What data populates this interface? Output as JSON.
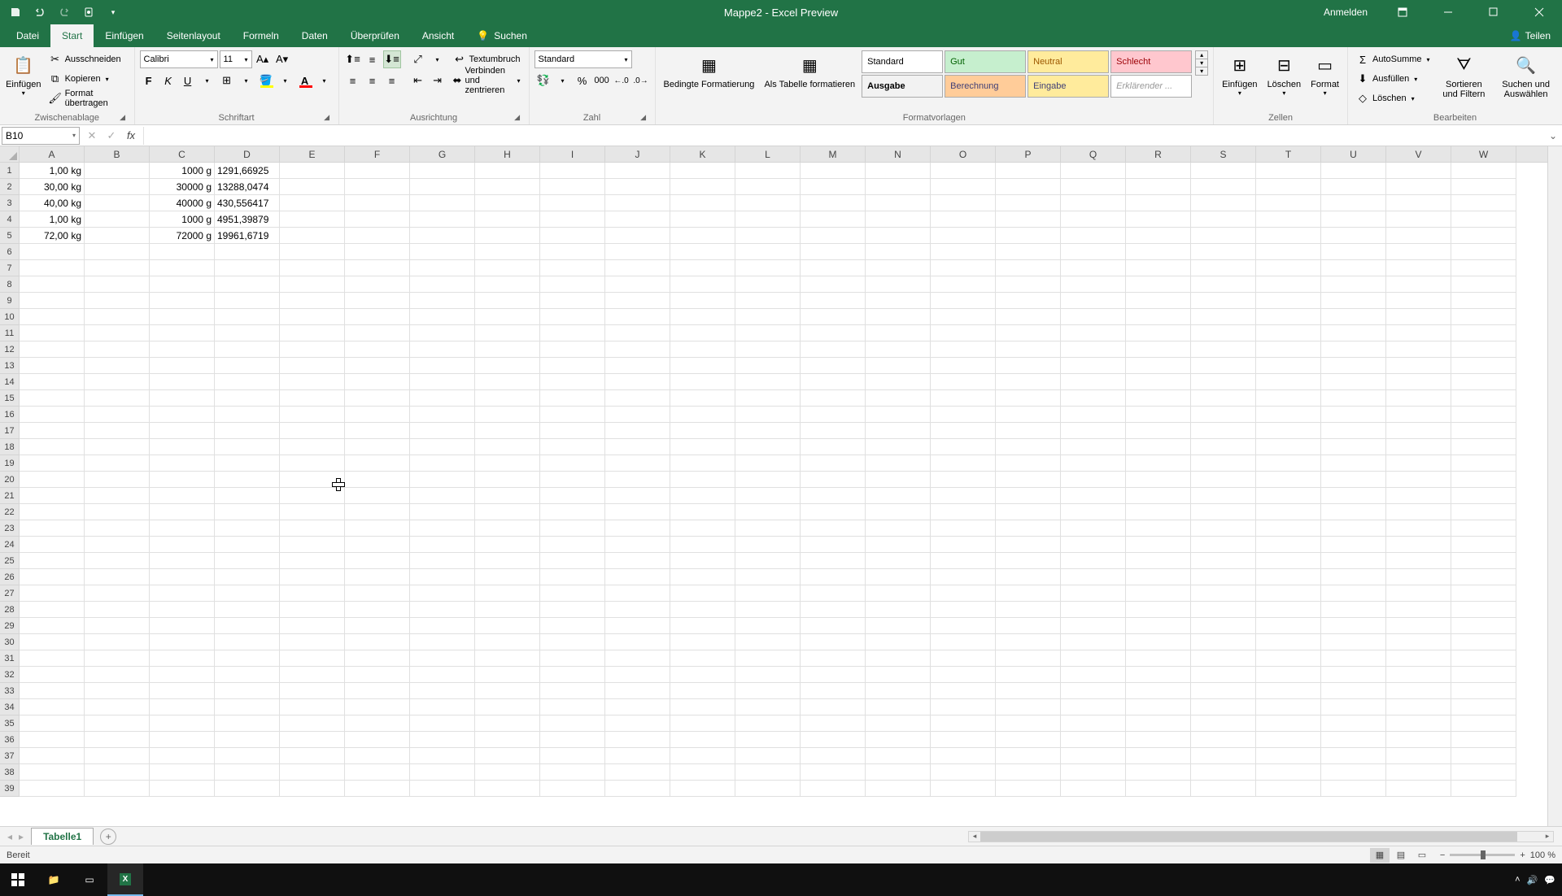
{
  "titlebar": {
    "title": "Mappe2 - Excel Preview",
    "signin": "Anmelden"
  },
  "tabs": {
    "items": [
      "Datei",
      "Start",
      "Einfügen",
      "Seitenlayout",
      "Formeln",
      "Daten",
      "Überprüfen",
      "Ansicht"
    ],
    "search_icon_label": "Suchen",
    "share": "Teilen"
  },
  "ribbon": {
    "clipboard": {
      "paste": "Einfügen",
      "cut": "Ausschneiden",
      "copy": "Kopieren",
      "format_painter": "Format übertragen",
      "label": "Zwischenablage"
    },
    "font": {
      "name": "Calibri",
      "size": "11",
      "label": "Schriftart"
    },
    "alignment": {
      "wrap": "Textumbruch",
      "merge": "Verbinden und zentrieren",
      "label": "Ausrichtung"
    },
    "number": {
      "format": "Standard",
      "label": "Zahl"
    },
    "styles": {
      "cond": "Bedingte Formatierung",
      "table": "Als Tabelle formatieren",
      "standard": "Standard",
      "gut": "Gut",
      "neutral": "Neutral",
      "schlecht": "Schlecht",
      "ausgabe": "Ausgabe",
      "berech": "Berechnung",
      "eingabe": "Eingabe",
      "erklar": "Erklärender ...",
      "label": "Formatvorlagen"
    },
    "cells": {
      "insert": "Einfügen",
      "delete": "Löschen",
      "format": "Format",
      "label": "Zellen"
    },
    "editing": {
      "sum": "AutoSumme",
      "fill": "Ausfüllen",
      "clear": "Löschen",
      "sort": "Sortieren und Filtern",
      "find": "Suchen und Auswählen",
      "label": "Bearbeiten"
    }
  },
  "fbar": {
    "namebox": "B10",
    "formula": ""
  },
  "grid": {
    "cols": [
      "A",
      "B",
      "C",
      "D",
      "E",
      "F",
      "G",
      "H",
      "I",
      "J",
      "K",
      "L",
      "M",
      "N",
      "O",
      "P",
      "Q",
      "R",
      "S",
      "T",
      "U",
      "V",
      "W"
    ],
    "rows": 39,
    "data": [
      {
        "r": 1,
        "A": "1,00 kg",
        "C": "1000 g",
        "D": "1291,66925"
      },
      {
        "r": 2,
        "A": "30,00 kg",
        "C": "30000 g",
        "D": "13288,0474"
      },
      {
        "r": 3,
        "A": "40,00 kg",
        "C": "40000 g",
        "D": "430,556417"
      },
      {
        "r": 4,
        "A": "1,00 kg",
        "C": "1000 g",
        "D": "4951,39879"
      },
      {
        "r": 5,
        "A": "72,00 kg",
        "C": "72000 g",
        "D": "19961,6719"
      }
    ]
  },
  "sheettabs": {
    "active": "Tabelle1"
  },
  "statusbar": {
    "ready": "Bereit",
    "zoom": "100 %"
  }
}
